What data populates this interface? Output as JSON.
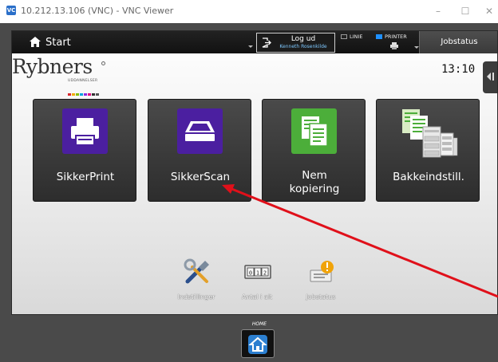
{
  "window": {
    "app_badge": "VC",
    "title": "10.212.13.106 (VNC) - VNC Viewer",
    "minimize_glyph": "–",
    "maximize_glyph": "☐",
    "close_glyph": "✕"
  },
  "topbar": {
    "start_label": "Start",
    "logout": {
      "line1": "Log ud",
      "line2": "Kenneth Rosenkilde"
    },
    "indicators": [
      {
        "label": "LINIE",
        "color": "#222222"
      },
      {
        "label": "PRINTER",
        "color": "#1e90ff"
      }
    ],
    "jobstatus_label": "Jobstatus"
  },
  "brand": {
    "name": "Rybners",
    "subtitle": "UDDANNELSER",
    "dot_colors": [
      "#d9272e",
      "#f2a900",
      "#84bd00",
      "#00a3e0",
      "#8a2be2",
      "#e4007c",
      "#333333",
      "#555555"
    ]
  },
  "clock": "13:10",
  "tiles": [
    {
      "label": "SikkerPrint",
      "icon": "printer-icon",
      "bg": "#4b1fa0"
    },
    {
      "label": "SikkerScan",
      "icon": "scanner-icon",
      "bg": "#4b1fa0"
    },
    {
      "label_line1": "Nem",
      "label_line2": "kopiering",
      "icon": "copy-icon",
      "bg": "#4cae3a"
    },
    {
      "label": "Bakkeindstill.",
      "icon": "tray-settings-icon",
      "bg": "none"
    }
  ],
  "utilities": [
    {
      "label": "Indstillinger",
      "icon": "tools-icon"
    },
    {
      "label": "Antal i alt",
      "icon": "counter-icon",
      "counter_text": "012"
    },
    {
      "label": "Jobstatus",
      "icon": "job-status-icon"
    }
  ],
  "home_key": {
    "label": "HOME",
    "icon": "home-icon"
  },
  "annotation": {
    "color": "#e0101a"
  }
}
